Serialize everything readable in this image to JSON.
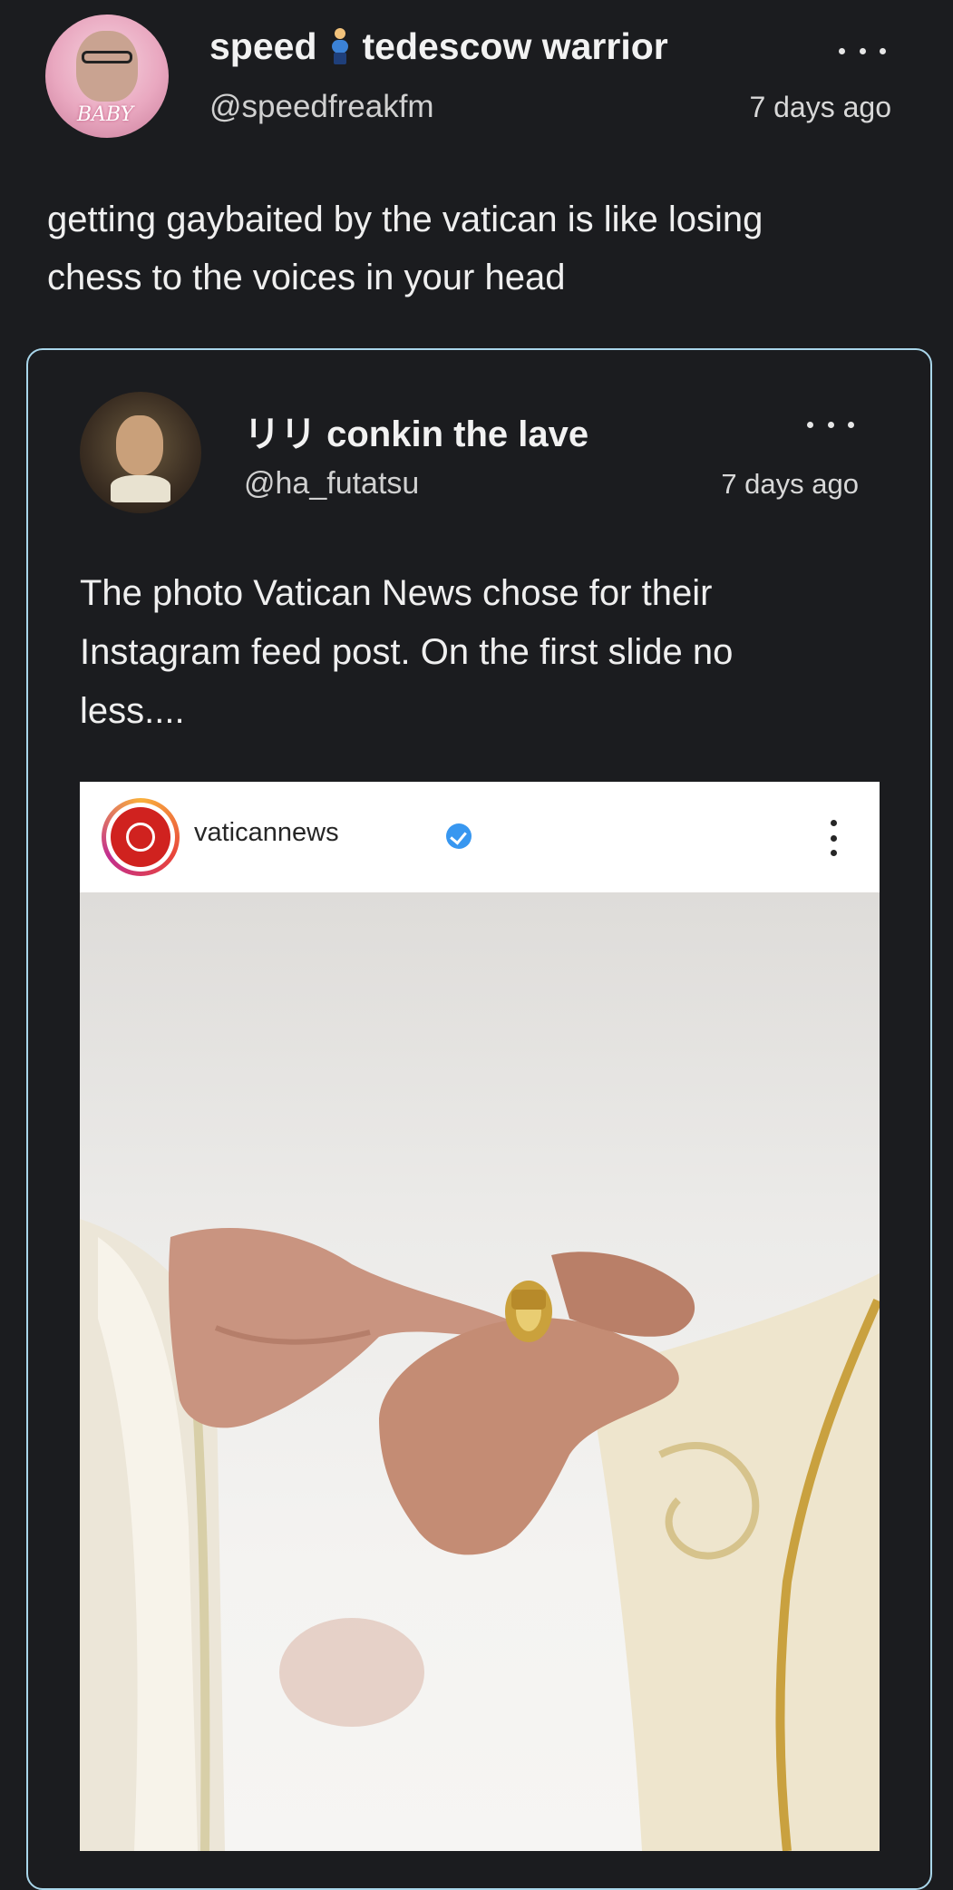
{
  "post": {
    "author": {
      "name_part1": "speed",
      "name_part2": "tedescow warrior",
      "name_emoji": "pregnant-man-emoji",
      "handle": "@speedfreakfm",
      "avatar_caption": "BABY"
    },
    "timestamp": "7 days ago",
    "text_line1": "getting gaybaited by the vatican is like losing",
    "text_line2": "chess to the voices in your head"
  },
  "quoted_post": {
    "author": {
      "name": "リリ conkin the lave",
      "handle": "@ha_futatsu"
    },
    "timestamp": "7 days ago",
    "text_line1": "The photo Vatican News chose for their",
    "text_line2": "Instagram feed post. On the first slide no",
    "text_line3": "less....",
    "embedded_image": {
      "account": "vaticannews",
      "verified": true
    }
  },
  "icons": {
    "more": "more-horizontal-icon",
    "kebab": "more-vertical-icon",
    "verified": "verified-badge-icon"
  },
  "colors": {
    "background": "#1b1c1f",
    "card_border": "#a9d6ea",
    "verified_blue": "#3897f0",
    "vatican_red": "#d0221f"
  }
}
